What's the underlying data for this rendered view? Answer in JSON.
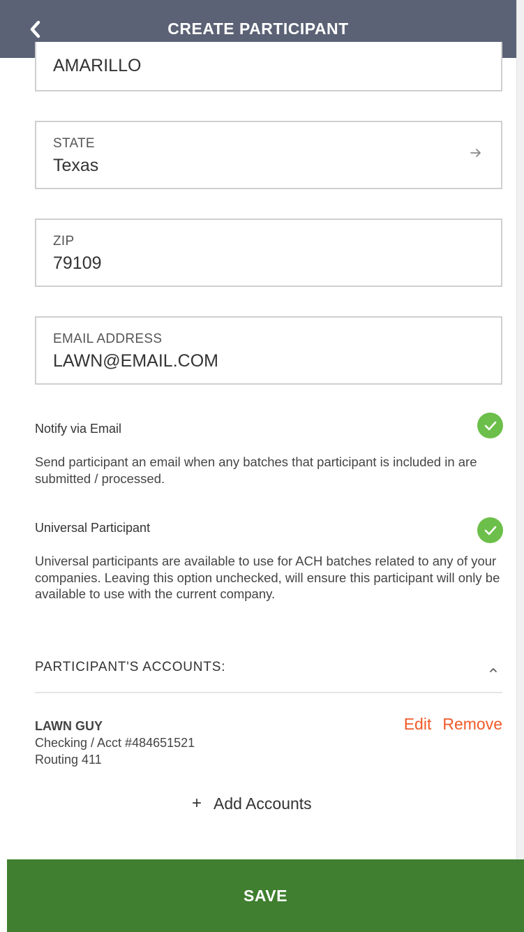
{
  "header": {
    "title": "CREATE PARTICIPANT",
    "back_icon": "chevron-left-icon"
  },
  "fields": {
    "city": {
      "value": "AMARILLO"
    },
    "state": {
      "label": "STATE",
      "value": "Texas",
      "icon": "arrow-right-icon"
    },
    "zip": {
      "label": "ZIP",
      "value": "79109"
    },
    "email": {
      "label": "EMAIL ADDRESS",
      "value": "LAWN@EMAIL.COM"
    }
  },
  "options": {
    "notify_email": {
      "label": "Notify via Email",
      "checked": true,
      "description": "Send participant an email when any batches that participant is included in are submitted / processed."
    },
    "universal": {
      "label": "Universal Participant",
      "checked": true,
      "description": "Universal participants are available to use for ACH batches related to any of your companies. Leaving this option unchecked, will ensure this participant will only be available to use with the current company."
    }
  },
  "accounts": {
    "title": "PARTICIPANT'S ACCOUNTS:",
    "items": [
      {
        "name": "LAWN GUY",
        "type_line": "Checking / Acct #484651521",
        "routing_line": "Routing 411",
        "edit_label": "Edit",
        "remove_label": "Remove"
      }
    ],
    "add_label": "Add Accounts",
    "add_icon": "plus-icon"
  },
  "footer": {
    "save_label": "SAVE"
  },
  "colors": {
    "header_bg": "#5b6275",
    "accent_orange": "#f05a28",
    "check_green": "#6cbf4a",
    "save_green": "#3f7f2f"
  }
}
